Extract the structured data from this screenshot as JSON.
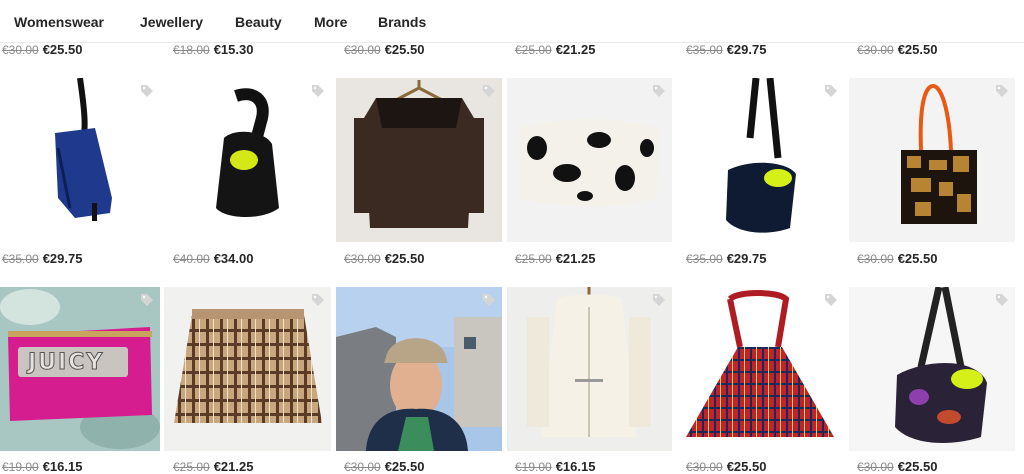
{
  "nav": {
    "items": [
      {
        "label": "Womenswear"
      },
      {
        "label": "Jewellery"
      },
      {
        "label": "Beauty"
      },
      {
        "label": "More"
      },
      {
        "label": "Brands"
      }
    ]
  },
  "prices": {
    "row0": [
      {
        "old": "€30.00",
        "new": "€25.50"
      },
      {
        "old": "€18.00",
        "new": "€15.30"
      },
      {
        "old": "€30.00",
        "new": "€25.50"
      },
      {
        "old": "€25.00",
        "new": "€21.25"
      },
      {
        "old": "€35.00",
        "new": "€29.75"
      },
      {
        "old": "€30.00",
        "new": "€25.50"
      }
    ],
    "row1": [
      {
        "old": "€35.00",
        "new": "€29.75"
      },
      {
        "old": "€40.00",
        "new": "€34.00"
      },
      {
        "old": "€30.00",
        "new": "€25.50"
      },
      {
        "old": "€25.00",
        "new": "€21.25"
      },
      {
        "old": "€35.00",
        "new": "€29.75"
      },
      {
        "old": "€30.00",
        "new": "€25.50"
      }
    ],
    "row2": [
      {
        "old": "€19.00",
        "new": "€16.15"
      },
      {
        "old": "€25.00",
        "new": "€21.25"
      },
      {
        "old": "€30.00",
        "new": "€25.50"
      },
      {
        "old": "€19.00",
        "new": "€16.15"
      },
      {
        "old": "€30.00",
        "new": "€25.50"
      },
      {
        "old": "€30.00",
        "new": "€25.50"
      }
    ]
  },
  "products": {
    "p9_text": "JUICY"
  },
  "icons": {
    "tag": "price-tag-icon"
  }
}
